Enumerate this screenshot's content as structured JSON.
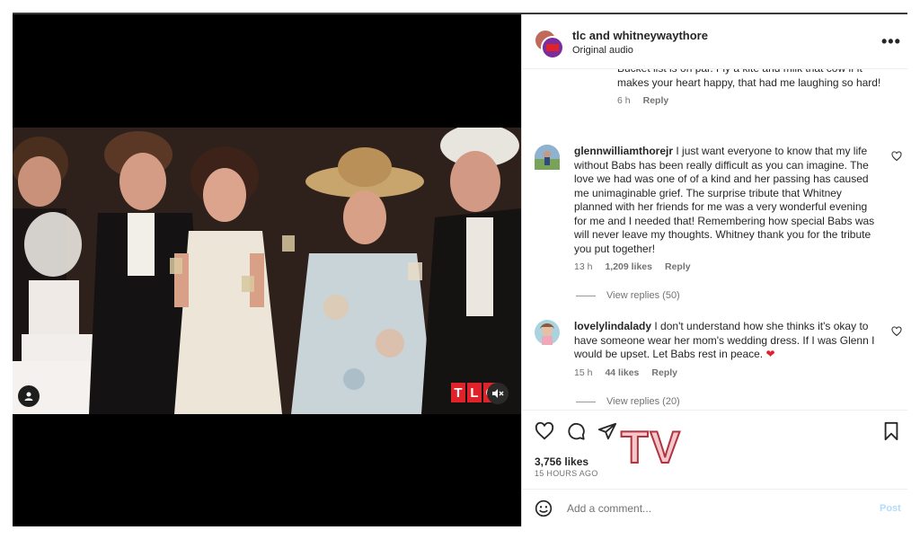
{
  "header": {
    "title": "tlc and whitneywaythore",
    "subtitle": "Original audio"
  },
  "media": {
    "logo_letters": [
      "T",
      "L",
      "C"
    ]
  },
  "comments": [
    {
      "text_partial": "Bucket list is on par. Fly a kite and milk that cow if it makes your heart happy, that had me laughing so hard!",
      "time": "6 h",
      "reply": "Reply"
    },
    {
      "username": "glennwilliamthorejr",
      "text": "I just want everyone to know that my life without Babs has been really difficult as you can imagine. The love we had was one of of a kind and her passing has caused me unimaginable grief. The surprise tribute that Whitney planned with her friends for me was a very wonderful evening for me and I needed that! Remembering how special Babs was will never leave my thoughts. Whitney thank you for the tribute you put together!",
      "time": "13 h",
      "likes": "1,209 likes",
      "reply": "Reply",
      "view_replies": "View replies (50)"
    },
    {
      "username": "lovelylindalady",
      "text": "I don't understand how she thinks it's okay to have someone wear her mom's wedding dress. If I was Glenn I would be upset. Let Babs rest in peace.",
      "time": "15 h",
      "likes": "44 likes",
      "reply": "Reply",
      "view_replies": "View replies (20)"
    }
  ],
  "actions": {
    "likes": "3,756 likes",
    "time": "15 HOURS AGO",
    "watermark": "TV"
  },
  "add_comment": {
    "placeholder": "Add a comment...",
    "post_label": "Post"
  },
  "colors": {
    "accent_red": "#e0232a",
    "post_disabled": "#b3dbff",
    "heart_emoji": "#e0232a"
  }
}
